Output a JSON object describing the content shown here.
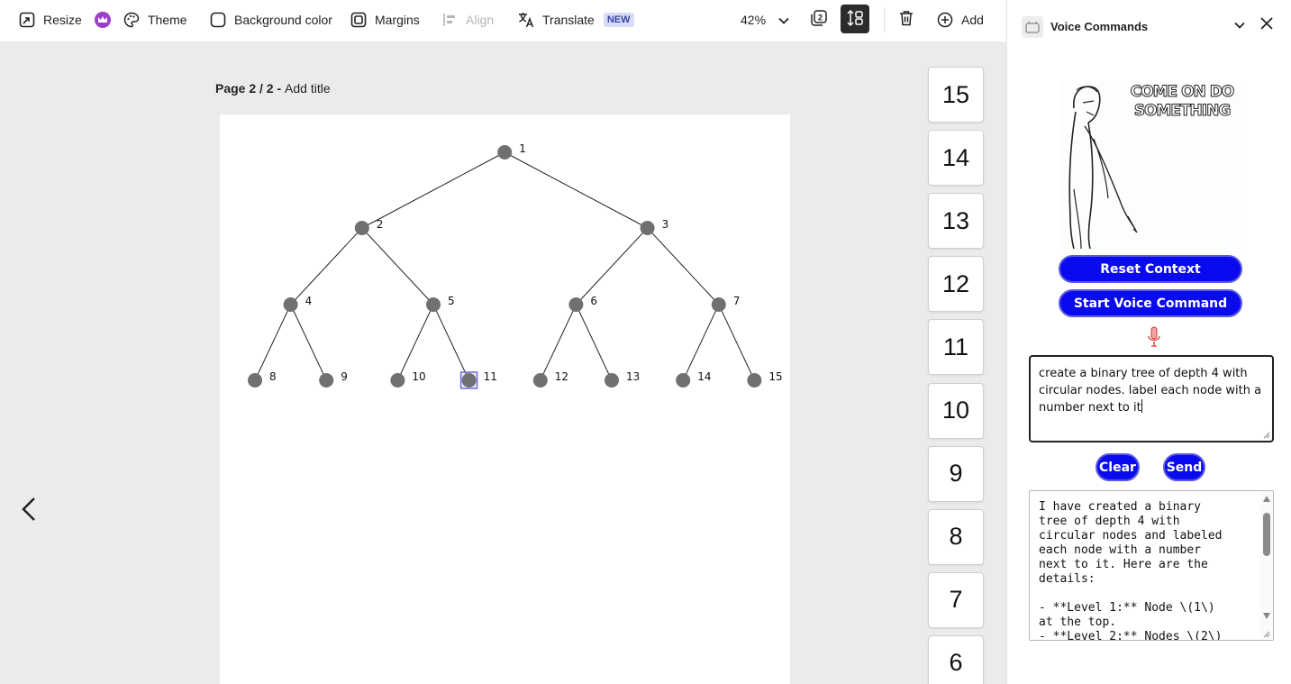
{
  "toolbar": {
    "resize_label": "Resize",
    "theme_label": "Theme",
    "background_label": "Background color",
    "margins_label": "Margins",
    "align_label": "Align",
    "translate_label": "Translate",
    "translate_badge": "NEW",
    "zoom_value": "42%",
    "add_label": "Add",
    "pages_count": "2"
  },
  "canvas": {
    "page_indicator": "Page 2 / 2",
    "page_separator": " - ",
    "add_title": "Add title"
  },
  "tree": {
    "node_color": "#707070",
    "selection_color": "#6b6bdc",
    "selected_node": "11",
    "labels": [
      "1",
      "2",
      "3",
      "4",
      "5",
      "6",
      "7",
      "8",
      "9",
      "10",
      "11",
      "12",
      "13",
      "14",
      "15"
    ]
  },
  "thumbnails": [
    "15",
    "14",
    "13",
    "12",
    "11",
    "10",
    "9",
    "8",
    "7",
    "6"
  ],
  "panel": {
    "title": "Voice Commands",
    "meme_caption_line1": "COME ON DO",
    "meme_caption_line2": "SOMETHING",
    "reset_label": "Reset Context",
    "voice_label": "Start Voice Command",
    "prompt_text": "create a binary tree of depth 4 with circular nodes. label each node with a number next to it",
    "clear_label": "Clear",
    "send_label": "Send",
    "response_text": "I have created a binary\ntree of depth 4 with\ncircular nodes and labeled\neach node with a number\nnext to it. Here are the\ndetails:\n\n- **Level 1:** Node \\(1\\)\nat the top.\n- **Level 2:** Nodes \\(2\\)",
    "button_color": "#0a0aee"
  }
}
